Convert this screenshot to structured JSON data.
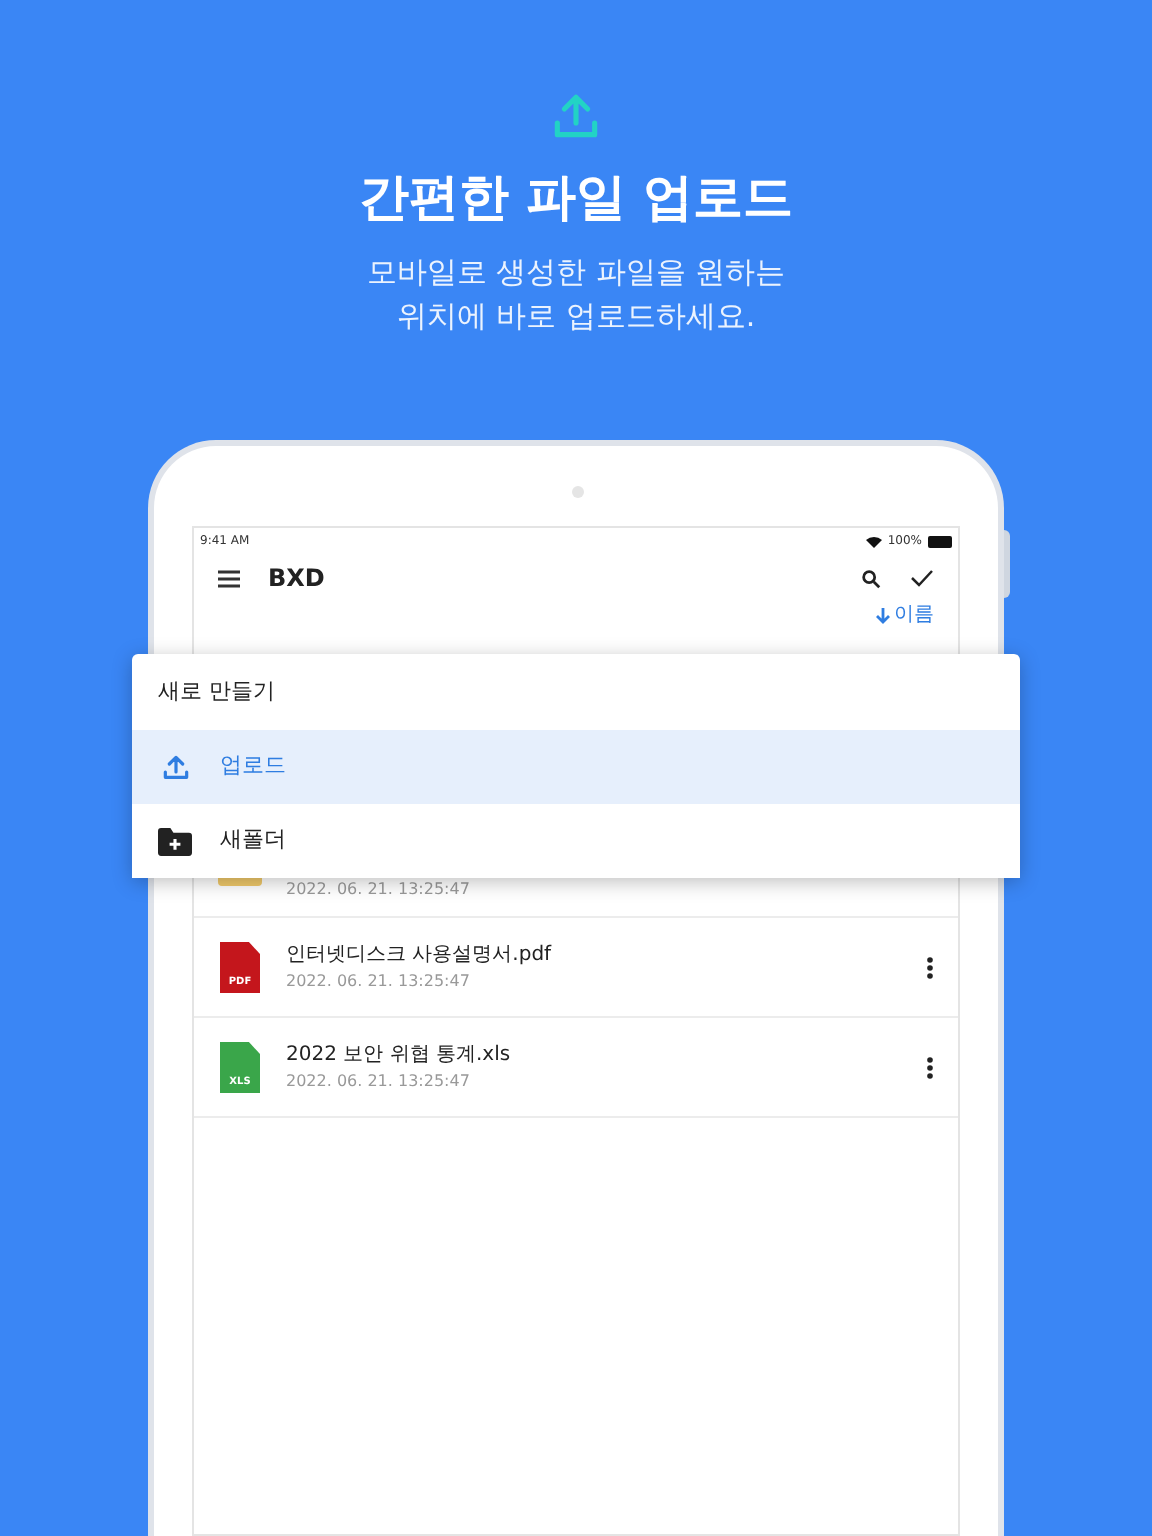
{
  "hero": {
    "title": "간편한 파일 업로드",
    "subtitle_lines": [
      "모바일로 생성한 파일을 원하는",
      "위치에 바로 업로드하세요."
    ]
  },
  "status_bar": {
    "time": "9:41 AM",
    "battery": "100%"
  },
  "toolbar": {
    "title": "BXD"
  },
  "sort": {
    "label": "이름"
  },
  "files": [
    {
      "kind": "folder",
      "date": "2022. 06. 21. 13:25:47"
    },
    {
      "kind": "pdf",
      "name": "인터넷디스크 사용설명서.pdf",
      "badge": "PDF",
      "date": "2022. 06. 21. 13:25:47"
    },
    {
      "kind": "xls",
      "name": "2022 보안 위협 통계.xls",
      "badge": "XLS",
      "date": "2022. 06. 21. 13:25:47"
    }
  ],
  "menu": {
    "title": "새로 만들기",
    "items": [
      {
        "kind": "upload",
        "label": "업로드",
        "selected": true
      },
      {
        "kind": "new-folder",
        "label": "새폴더",
        "selected": false
      }
    ]
  }
}
